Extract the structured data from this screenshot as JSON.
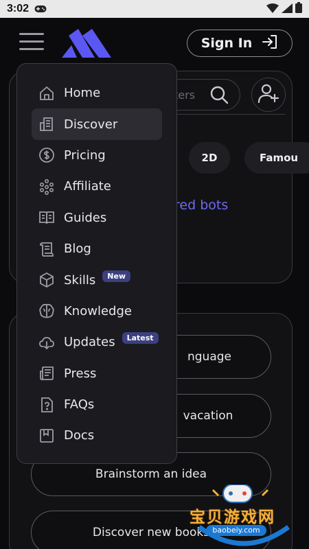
{
  "status_bar": {
    "time": "3:02"
  },
  "header": {
    "sign_in_label": "Sign In"
  },
  "search": {
    "placeholder_fragment": "ters"
  },
  "chips": [
    "2D",
    "Famou"
  ],
  "featured_text": "ured bots",
  "suggestions": [
    "nguage",
    "vacation",
    "Brainstorm an idea",
    "Discover new books"
  ],
  "menu": {
    "items": [
      {
        "label": "Home",
        "icon": "home-icon",
        "active": false
      },
      {
        "label": "Discover",
        "icon": "building-icon",
        "active": true
      },
      {
        "label": "Pricing",
        "icon": "dollar-icon",
        "active": false
      },
      {
        "label": "Affiliate",
        "icon": "dots-grid-icon",
        "active": false
      },
      {
        "label": "Guides",
        "icon": "book-icon",
        "active": false
      },
      {
        "label": "Blog",
        "icon": "scroll-icon",
        "active": false
      },
      {
        "label": "Skills",
        "icon": "cube-icon",
        "active": false,
        "badge": "New"
      },
      {
        "label": "Knowledge",
        "icon": "brain-icon",
        "active": false
      },
      {
        "label": "Updates",
        "icon": "cloud-download-icon",
        "active": false,
        "badge": "Latest"
      },
      {
        "label": "Press",
        "icon": "newspaper-icon",
        "active": false
      },
      {
        "label": "FAQs",
        "icon": "question-file-icon",
        "active": false
      },
      {
        "label": "Docs",
        "icon": "bookmark-doc-icon",
        "active": false
      }
    ]
  },
  "watermark": {
    "title": "宝贝游戏网",
    "url": "baobeiy.com"
  },
  "colors": {
    "accent": "#6e6bf0",
    "badge": "#3c3f80",
    "background": "#0b0b0d",
    "menu_bg": "#1b1b1f"
  }
}
